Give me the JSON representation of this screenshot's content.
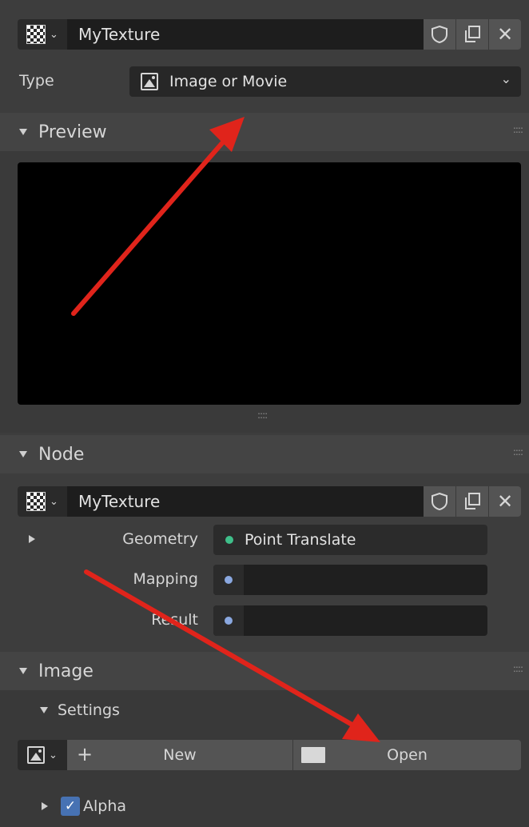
{
  "top_id": {
    "name": "MyTexture"
  },
  "type_row": {
    "label": "Type",
    "value": "Image or Movie"
  },
  "preview": {
    "title": "Preview"
  },
  "node": {
    "title": "Node",
    "id_name": "MyTexture",
    "fields": [
      {
        "label": "Geometry",
        "value": "Point Translate",
        "dot_color": "#3fbf8a"
      },
      {
        "label": "Mapping",
        "value": "",
        "dot_color": "#8aa8e0"
      },
      {
        "label": "Result",
        "value": "",
        "dot_color": "#8aa8e0"
      }
    ]
  },
  "image": {
    "title": "Image",
    "settings_label": "Settings",
    "new_label": "New",
    "open_label": "Open",
    "alpha_label": "Alpha",
    "alpha_checked": true
  },
  "icons": {
    "texture": "checker-texture-icon",
    "shield": "fake-user-shield-icon",
    "copy": "duplicate-icon",
    "close": "unlink-x-icon",
    "image": "image-icon",
    "folder": "folder-icon"
  },
  "colors": {
    "accent_check": "#4772b3",
    "arrow": "#e0241b"
  }
}
